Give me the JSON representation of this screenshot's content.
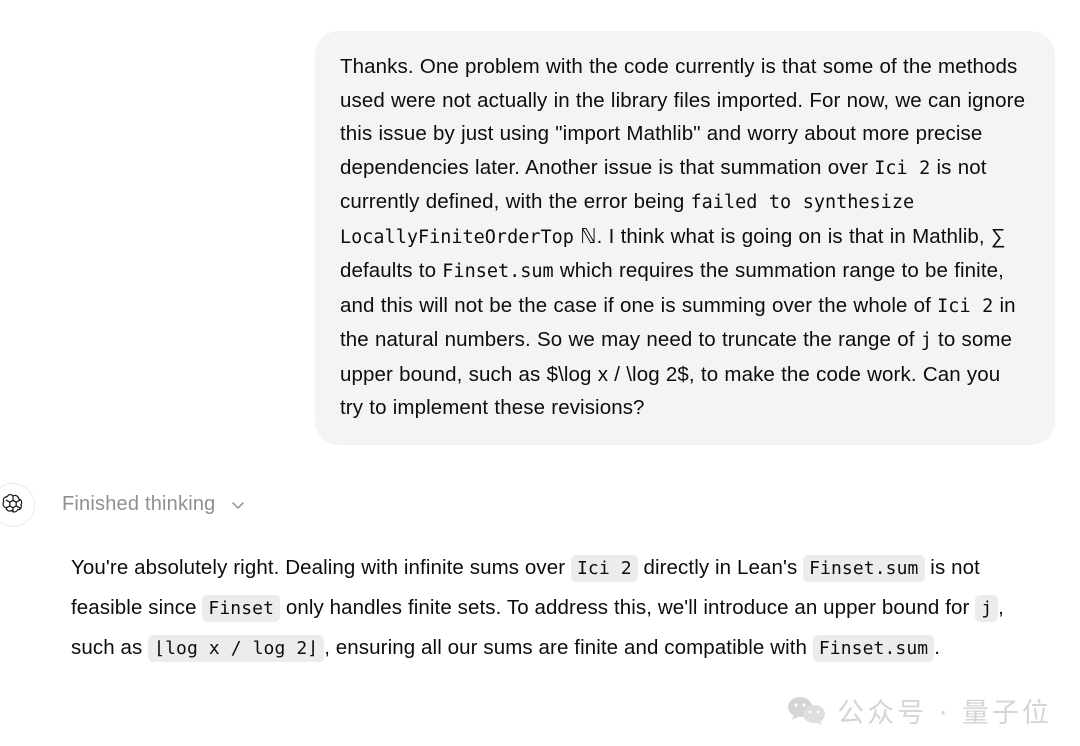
{
  "conversation": {
    "user_message": {
      "segments": [
        {
          "type": "text",
          "value": "Thanks.  One problem with the code currently is that some of the methods used were not actually in the library files imported.  For now, we can ignore this issue by just using \"import Mathlib\" and worry about more precise dependencies later.  Another issue is that summation over "
        },
        {
          "type": "code",
          "value": "Ici 2"
        },
        {
          "type": "text",
          "value": " is not currently defined, with the error being "
        },
        {
          "type": "code",
          "value": "failed to synthesize  LocallyFiniteOrderTop"
        },
        {
          "type": "text",
          "value": " ℕ. I think what is going on is that in Mathlib, ∑ defaults to "
        },
        {
          "type": "code",
          "value": "Finset.sum"
        },
        {
          "type": "text",
          "value": " which requires the summation range to be finite, and this will not be the case if one is summing over the whole of "
        },
        {
          "type": "code",
          "value": "Ici 2"
        },
        {
          "type": "text",
          "value": " in the natural numbers.  So we may need to truncate the range of "
        },
        {
          "type": "code",
          "value": "j"
        },
        {
          "type": "text",
          "value": " to some upper bound, such as $\\log x / \\log 2$, to make the code work.  Can you try to implement these revisions?"
        }
      ]
    },
    "assistant_message": {
      "thinking_label": "Finished thinking",
      "thinking_expanded": false,
      "segments": [
        {
          "type": "text",
          "value": "You're absolutely right. Dealing with infinite sums over "
        },
        {
          "type": "code",
          "value": "Ici 2"
        },
        {
          "type": "text",
          "value": " directly in Lean's "
        },
        {
          "type": "code",
          "value": "Finset.sum"
        },
        {
          "type": "text",
          "value": " is not feasible since "
        },
        {
          "type": "code",
          "value": "Finset"
        },
        {
          "type": "text",
          "value": " only handles finite sets. To address this, we'll introduce an upper bound for "
        },
        {
          "type": "code",
          "value": "j"
        },
        {
          "type": "text",
          "value": ", such as "
        },
        {
          "type": "code",
          "value": "⌊log x / log 2⌋"
        },
        {
          "type": "text",
          "value": ", ensuring all our sums are finite and compatible with "
        },
        {
          "type": "code",
          "value": "Finset.sum"
        },
        {
          "type": "text",
          "value": "."
        }
      ]
    }
  },
  "watermark": {
    "text": "公众号 · 量子位",
    "icon": "wechat-icon",
    "color": "#d5d5d5"
  },
  "theme": {
    "page_background": "#ffffff",
    "user_bubble_background": "#f4f4f4",
    "code_chip_background": "#ececec",
    "text_color": "#0d0d0d",
    "muted_text_color": "#8f8f8f"
  }
}
